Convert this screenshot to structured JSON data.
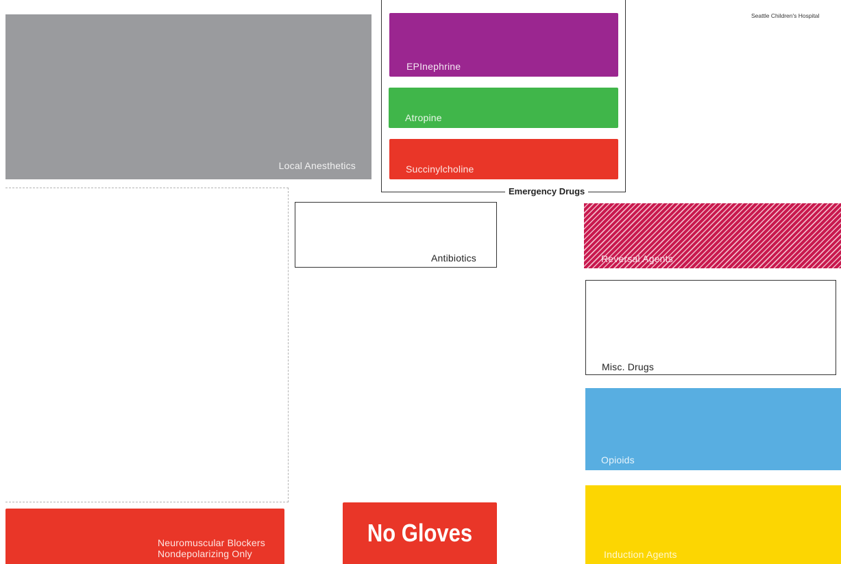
{
  "header": {
    "hospital_name": "Seattle Children's Hospital"
  },
  "zones": {
    "local_anesthetics": {
      "label": "Local Anesthetics",
      "color": "#9a9b9e"
    },
    "emergency_group": {
      "label": "Emergency Drugs",
      "items": [
        {
          "label": "EPInephrine",
          "color": "#9b2690"
        },
        {
          "label": "Atropine",
          "color": "#40b64a"
        },
        {
          "label": "Succinylcholine",
          "color": "#e93628"
        }
      ]
    },
    "antibiotics": {
      "label": "Antibiotics"
    },
    "reversal_agents": {
      "label": "Reversal Agents",
      "color": "#c8194e"
    },
    "misc_drugs": {
      "label": "Misc. Drugs"
    },
    "opioids": {
      "label": "Opioids",
      "color": "#58aee1"
    },
    "induction_agents": {
      "label": "Induction Agents",
      "color": "#fcd602"
    },
    "neuromuscular_blockers": {
      "label_line1": "Neuromuscular Blockers",
      "label_line2": "Nondepolarizing Only",
      "color": "#e93628"
    },
    "no_gloves": {
      "label": "No Gloves",
      "color": "#e93628"
    }
  }
}
